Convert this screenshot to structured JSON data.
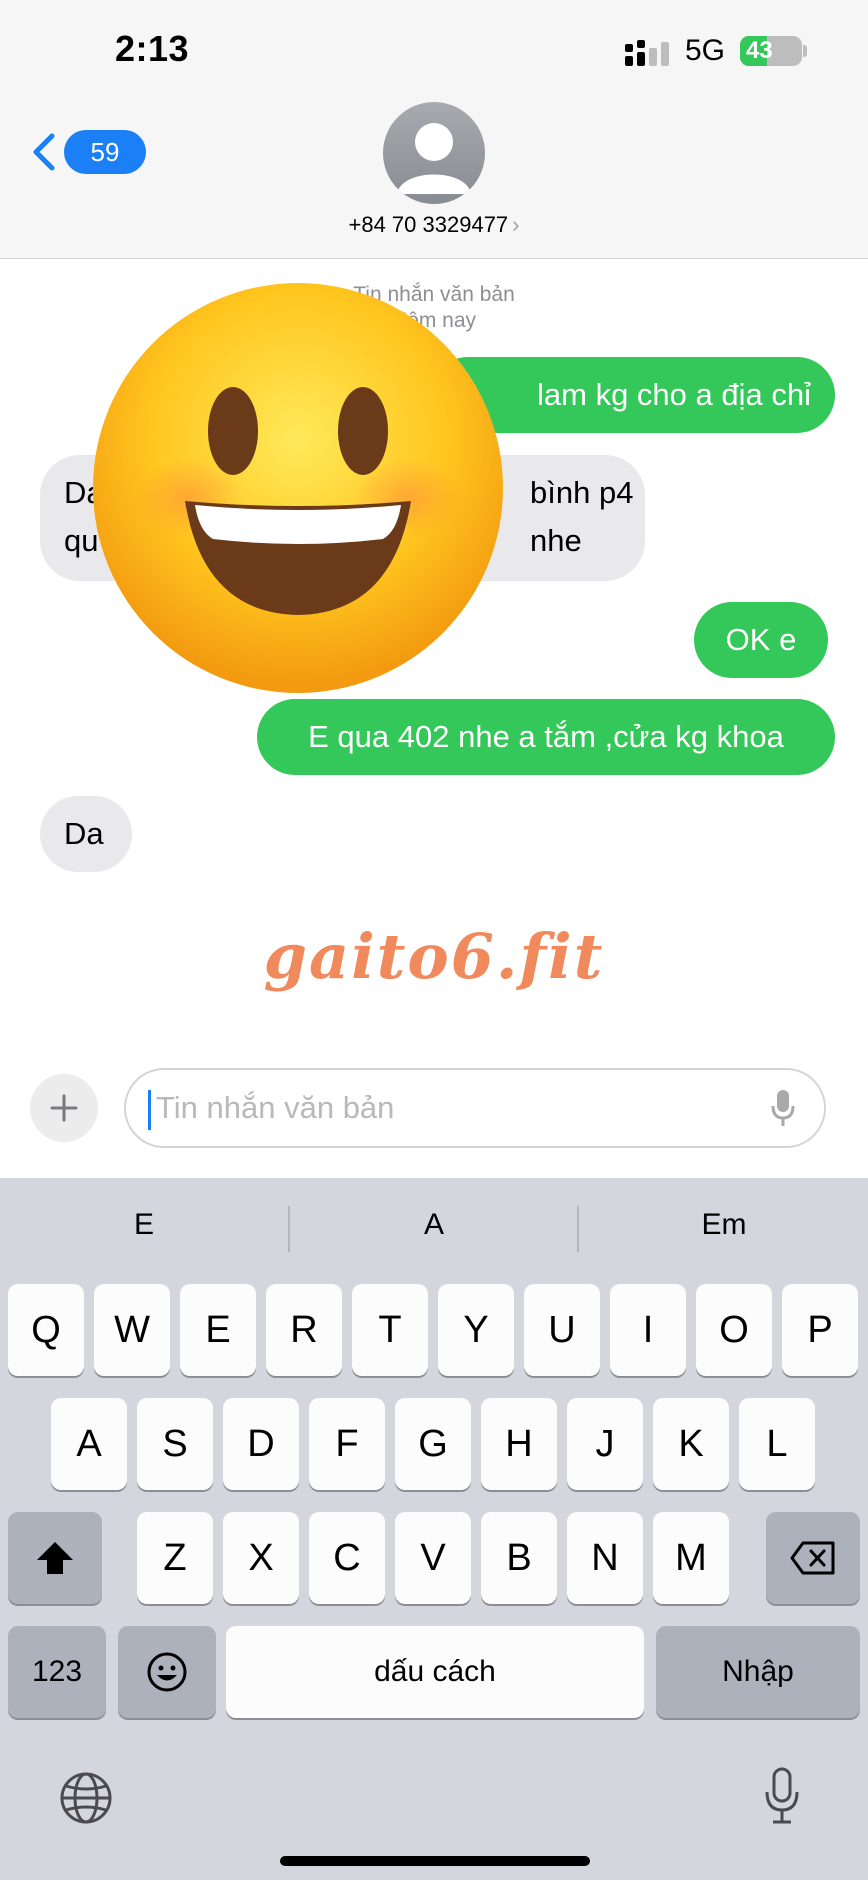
{
  "status_bar": {
    "time": "2:13",
    "network": "5G",
    "battery": "43",
    "battery_level": 0.43
  },
  "header": {
    "back_count": "59",
    "contact": "+84 70 3329477",
    "contact_chevron": "›"
  },
  "thread": {
    "timestamp_line1": "Tin nhắn văn bản",
    "timestamp_line2": "Hôm nay",
    "messages": [
      {
        "direction": "outgoing",
        "text": "lam kg cho a địa chỉ"
      },
      {
        "direction": "incoming",
        "line1": "Da",
        "line1b": "bình p4",
        "line2": "qu",
        "line2b": "nhe"
      },
      {
        "direction": "outgoing",
        "text": "OK e"
      },
      {
        "direction": "outgoing",
        "text": "E qua 402 nhe a tắm ,cửa kg khoa"
      },
      {
        "direction": "incoming",
        "text": "Da"
      }
    ]
  },
  "overlay": {
    "emoji": "grinning-face-emoji"
  },
  "watermark": "gaito6.fit",
  "input_bar": {
    "add_icon": "+",
    "placeholder": "Tin nhắn văn bản",
    "mic_icon": "mic-icon"
  },
  "keyboard": {
    "suggestions": [
      "E",
      "A",
      "Em"
    ],
    "row1": [
      "Q",
      "W",
      "E",
      "R",
      "T",
      "Y",
      "U",
      "I",
      "O",
      "P"
    ],
    "row2": [
      "A",
      "S",
      "D",
      "F",
      "G",
      "H",
      "J",
      "K",
      "L"
    ],
    "row3": [
      "Z",
      "X",
      "C",
      "V",
      "B",
      "N",
      "M"
    ],
    "numbers_label": "123",
    "space_label": "dấu cách",
    "return_label": "Nhập"
  },
  "colors": {
    "outgoing_bubble": "#34c759",
    "incoming_bubble": "#e9e9eb",
    "accent": "#1b7ff6",
    "watermark": "#f08a5d"
  }
}
